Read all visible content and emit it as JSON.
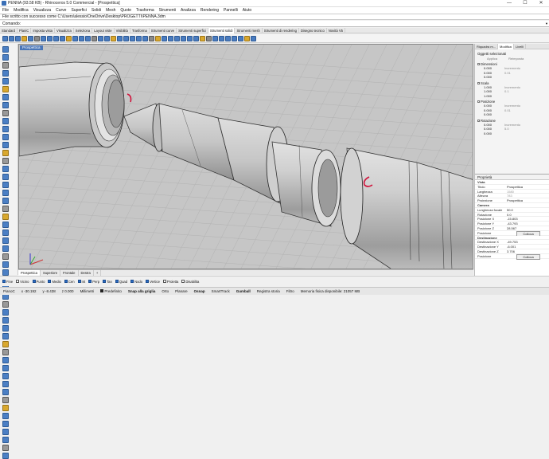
{
  "window": {
    "title": "PENNA (93.58 KB) - Rhinoceros 5.0 Commercial - [Prospettica]",
    "controls": [
      "—",
      "☐",
      "✕"
    ]
  },
  "menu": [
    "File",
    "Modifica",
    "Visualizza",
    "Curve",
    "Superfici",
    "Solidi",
    "Mesh",
    "Quote",
    "Trasforma",
    "Strumenti",
    "Analizza",
    "Rendering",
    "Pannelli",
    "Aiuto"
  ],
  "command_history": "File scritto con successo come C:\\Users\\alessio\\OneDrive\\Desktop\\PROGETTI\\PENNA.3dm",
  "command": {
    "label": "Comando:",
    "value": ""
  },
  "toolbar_tabs": [
    "Standard",
    "PlaniC",
    "Imposta vista",
    "Visualizza",
    "Seleziona",
    "Layout viste",
    "Visibilità",
    "Trasforma",
    "Strumenti curve",
    "Strumenti superfici",
    "Strumenti solidi",
    "Strumenti mesh",
    "Strumenti di rendering",
    "Disegno tecnico",
    "Novità V5"
  ],
  "toolbar_active_tab": "Strumenti solidi",
  "viewport": {
    "label": "Prospettica"
  },
  "viewport_tabs": [
    "Prospettica",
    "Superiore",
    "Frontale",
    "Destra"
  ],
  "viewport_tabs_add": "+",
  "osnaps": [
    {
      "label": "Fine",
      "on": true
    },
    {
      "label": "Vicino",
      "on": false
    },
    {
      "label": "Punto",
      "on": true
    },
    {
      "label": "Medio",
      "on": true
    },
    {
      "label": "Cen",
      "on": true
    },
    {
      "label": "Int",
      "on": true
    },
    {
      "label": "Perp",
      "on": true
    },
    {
      "label": "Tan",
      "on": true
    },
    {
      "label": "Quad",
      "on": true
    },
    {
      "label": "Nodo",
      "on": true
    },
    {
      "label": "Vertice",
      "on": true
    },
    {
      "label": "Proietta",
      "on": false
    },
    {
      "label": "Disabilita",
      "on": false
    }
  ],
  "statusbar": {
    "plane": "PianoC",
    "x": "x -30.192",
    "y": "y -8.438",
    "z": "z 0.000",
    "units": "Millimetri",
    "layer": "Predefinito",
    "toggles": [
      "Snap alla griglia",
      "Orto",
      "Planare",
      "Osnap",
      "SmartTrack",
      "Gumball",
      "Registra storia",
      "Filtro"
    ],
    "bold_toggles": [
      "Snap alla griglia",
      "Osnap",
      "Gumball"
    ],
    "memory": "Memoria fisica disponibile: 21057 MB"
  },
  "panel": {
    "tabs": [
      "Riquadra m...",
      "Modifica",
      "Livelli"
    ],
    "heading": "Oggetti selezionati",
    "actions": [
      "Applica",
      "Reimposta"
    ],
    "groups": [
      {
        "name": "Dimensioni",
        "values": [
          "0.000",
          "0.000",
          "0.000"
        ],
        "incr_label": "Incremento",
        "incr_value": "0.01"
      },
      {
        "name": "Scala",
        "values": [
          "1.000",
          "1.000",
          "1.000"
        ],
        "incr_label": "Incremento",
        "incr_value": "0.1"
      },
      {
        "name": "Posizione",
        "values": [
          "0.000",
          "0.000",
          "0.000"
        ],
        "incr_label": "Incremento",
        "incr_value": "0.01"
      },
      {
        "name": "Rotazione",
        "values": [
          "0.000",
          "0.000",
          "0.000"
        ],
        "incr_label": "Incremento",
        "incr_value": "5.0"
      }
    ]
  },
  "properties": {
    "header": "Proprietà",
    "rows": [
      {
        "k": "Vista",
        "v": "",
        "sec": true
      },
      {
        "k": "Titolo",
        "v": "Prospettica"
      },
      {
        "k": "Larghezza",
        "v": "1580",
        "dim": true
      },
      {
        "k": "Altezza",
        "v": "783",
        "dim": true
      },
      {
        "k": "Proiezione",
        "v": "Prospettica"
      },
      {
        "k": "Camera",
        "v": "",
        "sec": true
      },
      {
        "k": "Lunghezza focale",
        "v": "50.0"
      },
      {
        "k": "Rotazione",
        "v": "0.0"
      },
      {
        "k": "Posizione X",
        "v": "-15.803"
      },
      {
        "k": "Posizione Y",
        "v": "-43.793"
      },
      {
        "k": "Posizione Z",
        "v": "28.567"
      },
      {
        "k": "Posizione",
        "v": "Colloca",
        "btn": true
      },
      {
        "k": "Destinazione",
        "v": "",
        "sec": true
      },
      {
        "k": "Destinazione X",
        "v": "-49.753"
      },
      {
        "k": "Destinazione Y",
        "v": "-6.001"
      },
      {
        "k": "Destinazione Z",
        "v": "3.706"
      },
      {
        "k": "Posizione",
        "v": "Colloca",
        "btn": true
      }
    ]
  },
  "colors": {
    "accent": "#4a76b8",
    "model": "#b9b9b9",
    "grid": "#c8c8c8",
    "annotation": "#d0143c"
  }
}
